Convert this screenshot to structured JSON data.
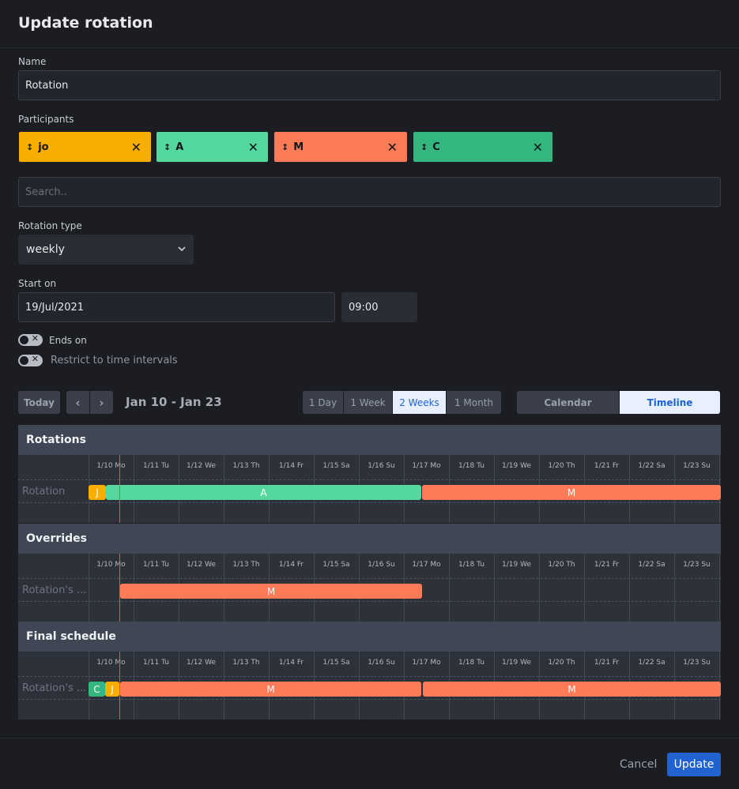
{
  "modal": {
    "title": "Update rotation"
  },
  "name": {
    "label": "Name",
    "value": "Rotation"
  },
  "participants": {
    "label": "Participants",
    "chips": [
      {
        "text": "jo",
        "color": "#f8ae01"
      },
      {
        "text": "A",
        "color": "#55d89e"
      },
      {
        "text": "M",
        "color": "#ff7a57"
      },
      {
        "text": "C",
        "color": "#34b77e"
      }
    ],
    "search_placeholder": "Search.."
  },
  "rotation_type": {
    "label": "Rotation type",
    "value": "weekly"
  },
  "start": {
    "label": "Start on",
    "date": "19/Jul/2021",
    "time": "09:00"
  },
  "toggles": {
    "ends_on": "Ends on",
    "restrict": "Restrict to time intervals"
  },
  "toolbar": {
    "today": "Today",
    "prev": "‹",
    "next": "›",
    "range": "Jan 10 - Jan 23",
    "views": [
      "1 Day",
      "1 Week",
      "2 Weeks",
      "1 Month"
    ],
    "active_view": "2 Weeks",
    "modes": [
      "Calendar",
      "Timeline"
    ],
    "active_mode": "Timeline"
  },
  "days": [
    "1/10 Mo",
    "1/11 Tu",
    "1/12 We",
    "1/13 Th",
    "1/14 Fr",
    "1/15 Sa",
    "1/16 Su",
    "1/17 Mo",
    "1/18 Tu",
    "1/19 We",
    "1/20 Th",
    "1/21 Fr",
    "1/22 Sa",
    "1/23 Su"
  ],
  "timeline": {
    "sections": [
      {
        "title": "Rotations",
        "row_label": "Rotation",
        "bars": [
          {
            "label": "J",
            "color": "#f8ae01"
          },
          {
            "label": "A",
            "color": "#55d89e"
          },
          {
            "label": "M",
            "color": "#ff7a57"
          }
        ]
      },
      {
        "title": "Overrides",
        "row_label": "Rotation's ...",
        "bars": [
          {
            "label": "M",
            "color": "#ff7a57"
          }
        ]
      },
      {
        "title": "Final schedule",
        "row_label": "Rotation's ...",
        "bars": [
          {
            "label": "C",
            "color": "#34b77e"
          },
          {
            "label": "J",
            "color": "#f8ae01"
          },
          {
            "label": "M",
            "color": "#ff7a57"
          },
          {
            "label": "M",
            "color": "#ff7a57"
          }
        ]
      }
    ]
  },
  "footer": {
    "cancel": "Cancel",
    "update": "Update"
  }
}
